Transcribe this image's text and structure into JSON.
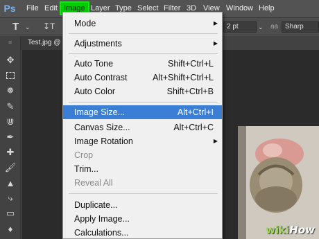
{
  "app": {
    "logo": "Ps"
  },
  "menubar": {
    "items": [
      {
        "label": "File"
      },
      {
        "label": "Edit"
      },
      {
        "label": "Image"
      },
      {
        "label": "Layer"
      },
      {
        "label": "Type"
      },
      {
        "label": "Select"
      },
      {
        "label": "Filter"
      },
      {
        "label": "3D"
      },
      {
        "label": "View"
      },
      {
        "label": "Window"
      },
      {
        "label": "Help"
      }
    ],
    "highlight_color": "#00cc00"
  },
  "options_bar": {
    "type_tool_glyph": "T",
    "size_value": "2 pt",
    "antialias_value": "Sharp"
  },
  "document": {
    "tab_label": "Test.jpg @"
  },
  "image_menu": {
    "items": [
      {
        "label": "Mode",
        "shortcut": "",
        "submenu": true,
        "state": "normal"
      },
      {
        "label": "Adjustments",
        "shortcut": "",
        "submenu": true,
        "state": "normal"
      },
      {
        "label": "Auto Tone",
        "shortcut": "Shift+Ctrl+L",
        "submenu": false,
        "state": "normal"
      },
      {
        "label": "Auto Contrast",
        "shortcut": "Alt+Shift+Ctrl+L",
        "submenu": false,
        "state": "normal"
      },
      {
        "label": "Auto Color",
        "shortcut": "Shift+Ctrl+B",
        "submenu": false,
        "state": "normal"
      },
      {
        "label": "Image Size...",
        "shortcut": "Alt+Ctrl+I",
        "submenu": false,
        "state": "highlighted"
      },
      {
        "label": "Canvas Size...",
        "shortcut": "Alt+Ctrl+C",
        "submenu": false,
        "state": "normal"
      },
      {
        "label": "Image Rotation",
        "shortcut": "",
        "submenu": true,
        "state": "normal"
      },
      {
        "label": "Crop",
        "shortcut": "",
        "submenu": false,
        "state": "disabled"
      },
      {
        "label": "Trim...",
        "shortcut": "",
        "submenu": false,
        "state": "normal"
      },
      {
        "label": "Reveal All",
        "shortcut": "",
        "submenu": false,
        "state": "disabled"
      },
      {
        "label": "Duplicate...",
        "shortcut": "",
        "submenu": false,
        "state": "normal"
      },
      {
        "label": "Apply Image...",
        "shortcut": "",
        "submenu": false,
        "state": "normal"
      },
      {
        "label": "Calculations...",
        "shortcut": "",
        "submenu": false,
        "state": "normal"
      }
    ],
    "highlight_color": "#3a7fd5"
  },
  "watermark": {
    "brand_a": "wiki",
    "brand_b": "How"
  },
  "toolbox": {
    "tools": [
      "move-tool-icon",
      "marquee-tool-icon",
      "lasso-tool-icon",
      "quick-select-tool-icon",
      "crop-tool-icon",
      "eyedropper-tool-icon",
      "healing-brush-icon",
      "brush-tool-icon",
      "clone-stamp-icon",
      "history-brush-icon",
      "eraser-tool-icon",
      "paint-bucket-icon"
    ]
  }
}
